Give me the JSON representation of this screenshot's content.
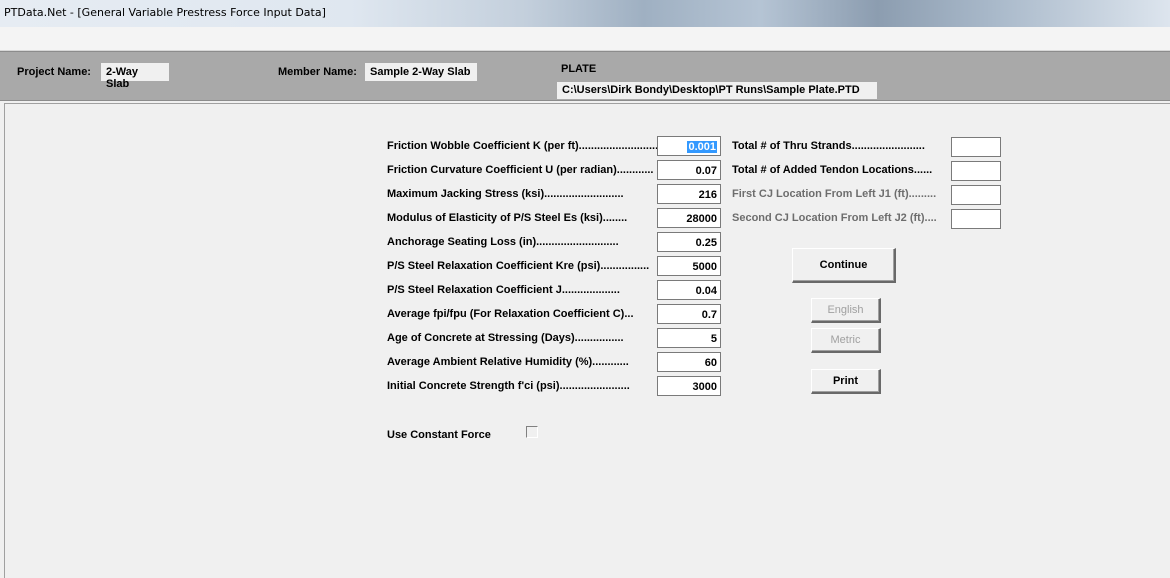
{
  "window": {
    "title": "PTData.Net - [General Variable Prestress Force Input Data]"
  },
  "header": {
    "project_label": "Project Name:",
    "project_value": "2-Way Slab",
    "member_label": "Member Name:",
    "member_value": "Sample 2-Way Slab",
    "type_value": "PLATE",
    "path_value": "C:\\Users\\Dirk Bondy\\Desktop\\PT Runs\\Sample Plate.PTD"
  },
  "left_fields": [
    {
      "label": "Friction Wobble Coefficient K (per ft)..........................",
      "value": "0.001"
    },
    {
      "label": "Friction Curvature Coefficient U (per radian)............",
      "value": "0.07"
    },
    {
      "label": "Maximum Jacking Stress (ksi)..........................",
      "value": "216"
    },
    {
      "label": "Modulus of Elasticity of P/S Steel Es (ksi)........",
      "value": "28000"
    },
    {
      "label": "Anchorage Seating Loss (in)...........................",
      "value": "0.25"
    },
    {
      "label": "P/S Steel Relaxation Coefficient Kre (psi)................",
      "value": "5000"
    },
    {
      "label": "P/S Steel Relaxation Coefficient J...................",
      "value": "0.04"
    },
    {
      "label": "Average fpi/fpu (For Relaxation Coefficient C)...",
      "value": "0.7"
    },
    {
      "label": "Age of Concrete at Stressing (Days)................",
      "value": "5"
    },
    {
      "label": "Average Ambient Relative Humidity (%)............",
      "value": "60"
    },
    {
      "label": "Initial Concrete Strength f'ci (psi).......................",
      "value": "3000"
    }
  ],
  "right_fields": [
    {
      "label": "Total # of Thru Strands........................",
      "value": ""
    },
    {
      "label": "Total # of Added Tendon Locations......",
      "value": ""
    },
    {
      "label": "First CJ Location From Left J1 (ft).........",
      "value": ""
    },
    {
      "label": "Second CJ Location From Left J2 (ft)....",
      "value": ""
    }
  ],
  "buttons": {
    "continue": "Continue",
    "english": "English",
    "metric": "Metric",
    "print": "Print"
  },
  "constant_force": {
    "label": "Use Constant Force",
    "checked": false
  }
}
